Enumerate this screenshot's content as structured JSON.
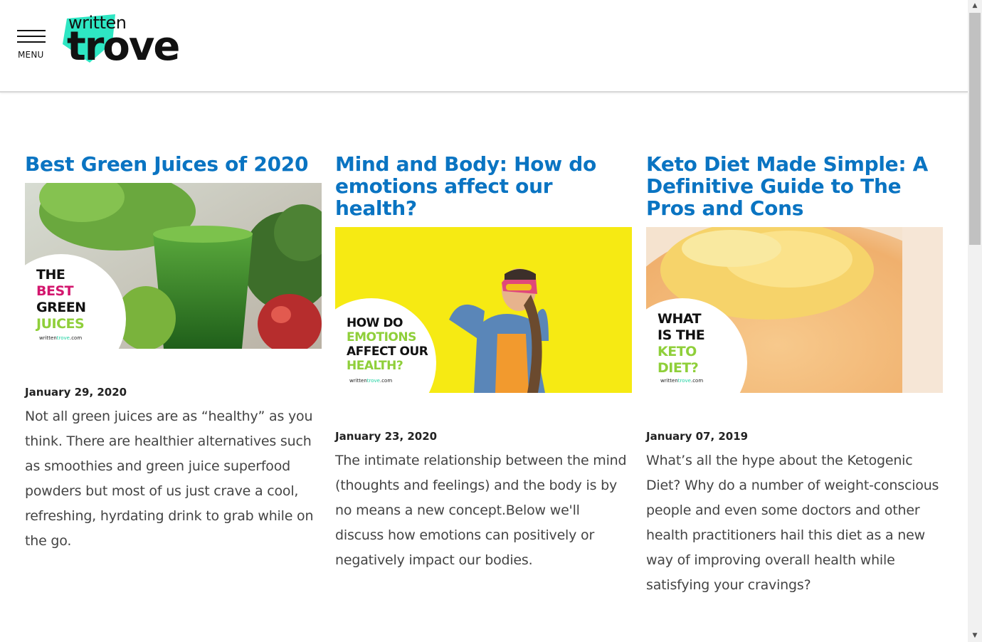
{
  "header": {
    "menu_label": "MENU",
    "logo_top": "written",
    "logo_main": "trove"
  },
  "posts": [
    {
      "title": "Best Green Juices of 2020",
      "date": "January 29, 2020",
      "excerpt": "Not all green juices are as “healthy” as you think. There are healthier alternatives such as smoothies and green juice superfood powders but most of us just crave a cool, refreshing, hyrdating drink to grab while on the go.",
      "thumb": {
        "l1": "THE",
        "l2": "BEST",
        "l3": "GREEN",
        "l4": "JUICES",
        "site_a": "written",
        "site_b": "trove",
        "site_c": ".com"
      }
    },
    {
      "title": "Mind and Body: How do emotions affect our health?",
      "date": "January 23, 2020",
      "excerpt": "The intimate relationship between the mind (thoughts and feelings) and the body is by no means a new concept.Below we'll discuss how emotions can positively or negatively impact our bodies.",
      "thumb": {
        "l1": "HOW DO",
        "l2": "EMOTIONS",
        "l3": "AFFECT OUR",
        "l4": "HEALTH?",
        "site_a": "written",
        "site_b": "trove",
        "site_c": ".com"
      }
    },
    {
      "title": "Keto Diet Made Simple: A Definitive Guide to The Pros and Cons",
      "date": "January 07, 2019",
      "excerpt": "What’s all the hype about the Ketogenic Diet? Why do a number of weight-conscious people and even some doctors and other health practitioners hail this diet as a new way of improving overall health while satisfying your cravings?",
      "thumb": {
        "l1": "WHAT",
        "l2": "IS THE",
        "l3": "KETO",
        "l4": "DIET?",
        "site_a": "written",
        "site_b": "trove",
        "site_c": ".com"
      }
    }
  ],
  "colors": {
    "title_blue": "#0a74c2",
    "logo_teal": "#2ee6c3",
    "accent_pink": "#d3176e",
    "accent_green": "#8fcf3a"
  },
  "icons": {
    "menu": "hamburger-icon",
    "scroll_up": "arrow-up-icon",
    "scroll_down": "arrow-down-icon"
  }
}
